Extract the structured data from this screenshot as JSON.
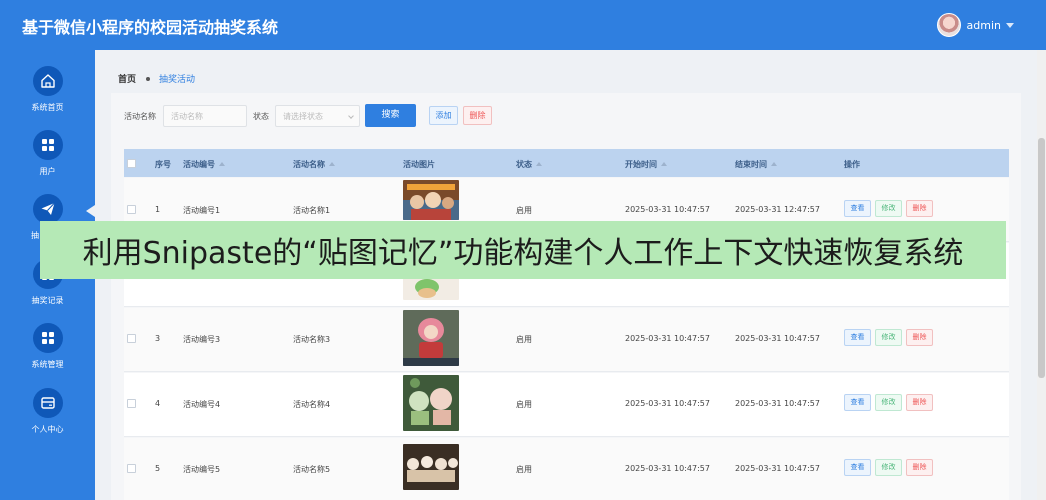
{
  "header": {
    "title": "基于微信小程序的校园活动抽奖系统",
    "username": "admin"
  },
  "sidebar": {
    "items": [
      {
        "label": "系统首页",
        "icon": "home-icon"
      },
      {
        "label": "用户",
        "icon": "grid-icon"
      },
      {
        "label": "抽",
        "icon": "paper-plane-icon"
      },
      {
        "label": "抽奖记录",
        "icon": "grid-icon"
      },
      {
        "label": "系统管理",
        "icon": "grid-icon"
      },
      {
        "label": "个人中心",
        "icon": "wallet-icon"
      }
    ]
  },
  "breadcrumb": {
    "home": "首页",
    "current": "抽奖活动"
  },
  "search": {
    "name_label": "活动名称",
    "name_placeholder": "活动名称",
    "status_label": "状态",
    "status_placeholder": "请选择状态",
    "search_button": "搜索",
    "add_button": "添加",
    "delete_button": "删除"
  },
  "table": {
    "headers": {
      "index": "序号",
      "code": "活动编号",
      "name": "活动名称",
      "image": "活动图片",
      "status": "状态",
      "start": "开始时间",
      "end": "结束时间",
      "actions": "操作"
    },
    "action_labels": {
      "view": "查看",
      "edit": "修改",
      "delete": "删除"
    },
    "rows": [
      {
        "index": "1",
        "code": "活动编号1",
        "name": "活动名称1",
        "status": "启用",
        "start": "2025-03-31 10:47:57",
        "end": "2025-03-31 12:47:57"
      },
      {
        "index": "3",
        "code": "活动编号3",
        "name": "活动名称3",
        "status": "启用",
        "start": "2025-03-31 10:47:57",
        "end": "2025-03-31 10:47:57"
      },
      {
        "index": "4",
        "code": "活动编号4",
        "name": "活动名称4",
        "status": "启用",
        "start": "2025-03-31 10:47:57",
        "end": "2025-03-31 10:47:57"
      },
      {
        "index": "5",
        "code": "活动编号5",
        "name": "活动名称5",
        "status": "启用",
        "start": "2025-03-31 10:47:57",
        "end": "2025-03-31 10:47:57"
      }
    ]
  },
  "banner": {
    "text": "利用Snipaste的“贴图记忆”功能构建个人工作上下文快速恢复系统"
  },
  "colors": {
    "primary": "#2f7fe0",
    "banner_bg": "#b5e9b6",
    "table_header": "#bcd3ef"
  }
}
